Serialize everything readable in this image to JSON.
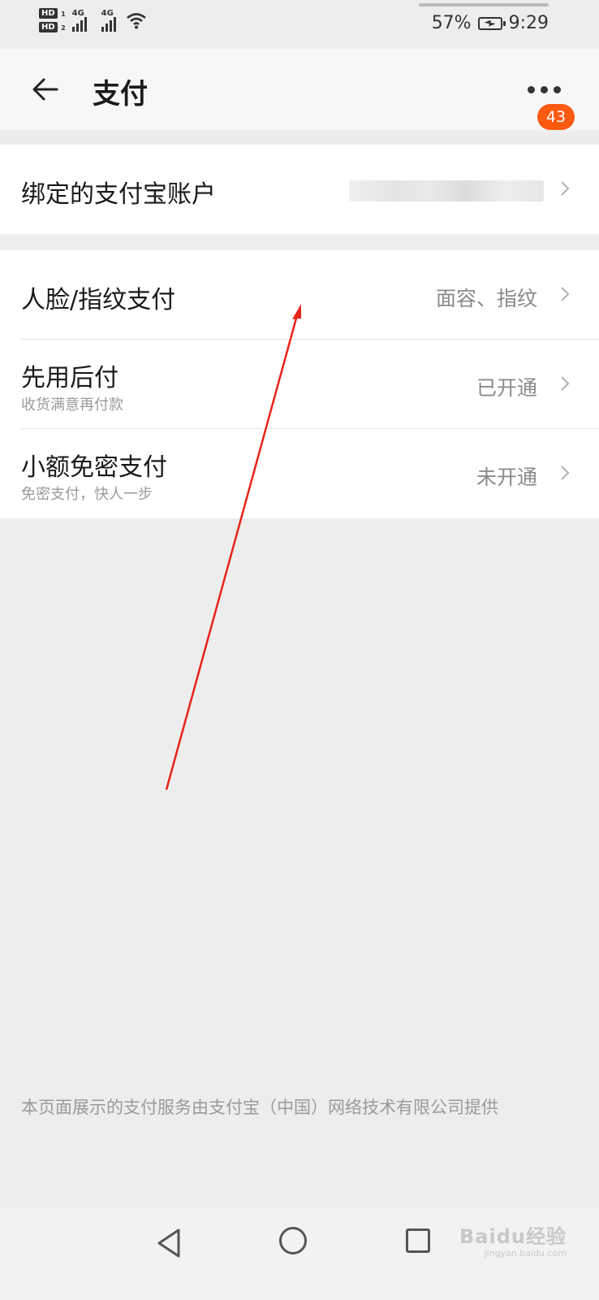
{
  "status_bar": {
    "hd1": "HD",
    "hd1_sub": "1",
    "hd2": "HD",
    "hd2_sub": "2",
    "net1": "4G",
    "net2": "4G",
    "battery_percent": "57%",
    "time": "9:29"
  },
  "header": {
    "title": "支付",
    "more_badge": "43",
    "icons": {
      "back": "back-arrow-icon",
      "more": "more-dots-icon"
    }
  },
  "sections": {
    "alipay": {
      "label": "绑定的支付宝账户",
      "value_obscured": true
    },
    "rows": [
      {
        "title": "人脸/指纹支付",
        "subtitle": "",
        "value": "面容、指纹"
      },
      {
        "title": "先用后付",
        "subtitle": "收货满意再付款",
        "value": "已开通"
      },
      {
        "title": "小额免密支付",
        "subtitle": "免密支付，快人一步",
        "value": "未开通"
      }
    ]
  },
  "footer_note": "本页面展示的支付服务由支付宝（中国）网络技术有限公司提供",
  "navigation_bar": {
    "icons": [
      "nav-back-icon",
      "nav-home-icon",
      "nav-recents-icon"
    ],
    "watermark": "Baidu经验",
    "watermark_sub": "jingyan.baidu.com"
  },
  "colors": {
    "background": "#ededed",
    "card": "#ffffff",
    "badge": "#fa5a12",
    "annotation_arrow": "#e8231b"
  }
}
